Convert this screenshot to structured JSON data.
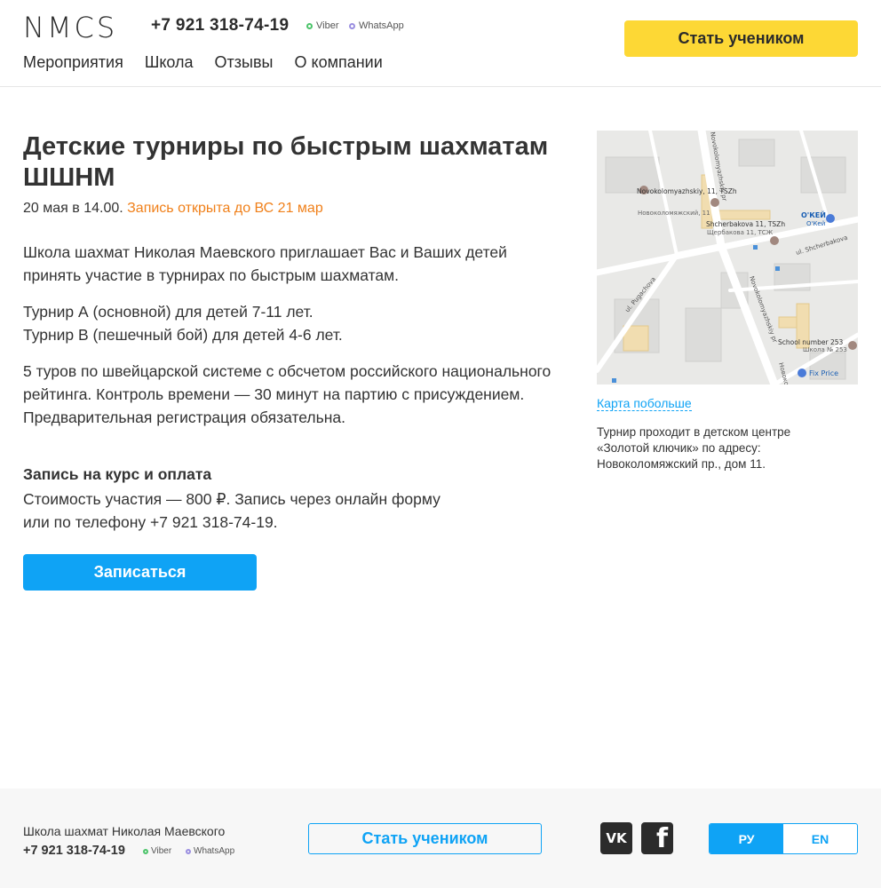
{
  "header": {
    "logo": "NMCS",
    "phone": "+7 921 318-74-19",
    "viber": "Viber",
    "whatsapp": "WhatsApp",
    "cta": "Стать учеником",
    "nav": [
      "Мероприятия",
      "Школа",
      "Отзывы",
      "О компании"
    ]
  },
  "event": {
    "title": "Детские турниры по быстрым шахматам ШШНМ",
    "date": "20 мая в 14.00.",
    "registration_status": "Запись открыта до ВС 21 мар",
    "intro": "Школа шахмат Николая Маевского приглашает Вас и Ваших детей принять участие в турнирах по быстрым шахматам.",
    "tournament_a": "Турнир А (основной) для детей 7-11 лет.",
    "tournament_b": "Турнир В (пешечный бой) для детей 4-6 лет.",
    "format": "5 туров по швейцарской системе с обсчетом российского национального рейтинга. Контроль времени — 30 минут на партию с присуждением. Предварительная регистрация обязательна.",
    "signup_heading": "Запись на курс и оплата",
    "signup_line1": "Стоимость участия — 800 ₽. Запись через онлайн форму",
    "signup_line2": "или по телефону +7 921 318-74-19.",
    "signup_button": "Записаться"
  },
  "map": {
    "labels": {
      "street1": "Novokolomyazhskiy pr",
      "street2": "ul. Shcherbakova",
      "street3": "ul. Pugachova",
      "street4": "Novokolomyazhskiy pr",
      "poi1_en": "Novokolomyazhskiy, 11, TSZh",
      "poi1_ru": "Новоколомяжский, 11",
      "poi2_en": "Shcherbakova 11, TSZh",
      "poi2_ru": "Щербакова 11, ТСЖ",
      "poi3_en": "O'КЕЙ",
      "poi3_ru": "О'Кей",
      "poi4_en": "School number 253",
      "poi4_ru": "Школа № 253",
      "poi5": "Fix Price",
      "edge": "Новоко"
    },
    "link": "Карта побольше",
    "caption": "Турнир проходит в детском центре «Золотой ключик» по адресу: Новоколомяжский пр., дом 11."
  },
  "footer": {
    "school": "Школа шахмат Николая Маевского",
    "phone": "+7 921 318-74-19",
    "viber": "Viber",
    "whatsapp": "WhatsApp",
    "cta": "Стать учеником",
    "vk_icon_text": "VK",
    "fb_icon_text": "f",
    "lang_ru": "РУ",
    "lang_en": "EN"
  },
  "colors": {
    "accent_yellow": "#fdd835",
    "accent_blue": "#0fa3f5",
    "accent_orange": "#f0801a",
    "text": "#333333"
  },
  "icons": [
    "viber-dot-icon",
    "whatsapp-dot-icon",
    "map-pin-icon",
    "vk-icon",
    "facebook-icon"
  ]
}
